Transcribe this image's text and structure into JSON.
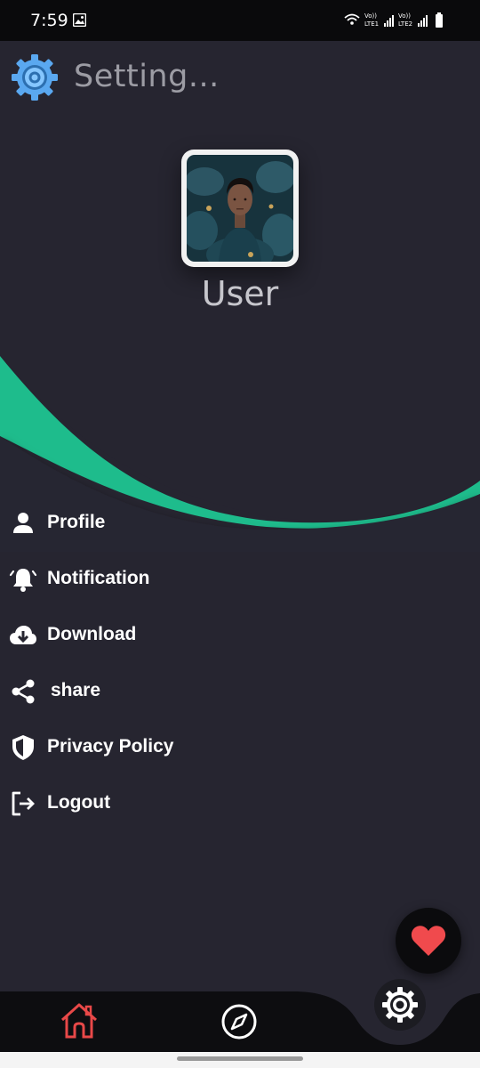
{
  "status_bar": {
    "time": "7:59",
    "network1": "LTE1",
    "network2": "LTE2",
    "volte1": "Vo))",
    "volte2": "Vo))"
  },
  "header": {
    "title": "Setting...",
    "logo_icon": "gear-logo-icon"
  },
  "profile": {
    "username": "User",
    "avatar_alt": "profile-photo"
  },
  "menu": {
    "items": [
      {
        "label": "Profile",
        "icon": "person-icon"
      },
      {
        "label": "Notification",
        "icon": "bell-icon"
      },
      {
        "label": "Download",
        "icon": "cloud-download-icon"
      },
      {
        "label": "share",
        "icon": "share-icon"
      },
      {
        "label": "Privacy Policy",
        "icon": "shield-icon"
      },
      {
        "label": "Logout",
        "icon": "logout-icon"
      }
    ]
  },
  "fab": {
    "icon": "heart-icon"
  },
  "bottom_nav": {
    "items": [
      {
        "icon": "home-icon",
        "active": true
      },
      {
        "icon": "compass-icon",
        "active": false
      },
      {
        "icon": "settings-gear-icon",
        "active": false
      }
    ]
  },
  "colors": {
    "background": "#262530",
    "accent_green": "#1ebc8c",
    "heart_red": "#f04a4d",
    "home_red": "#e84848",
    "title_gray": "#9c9ca4"
  }
}
